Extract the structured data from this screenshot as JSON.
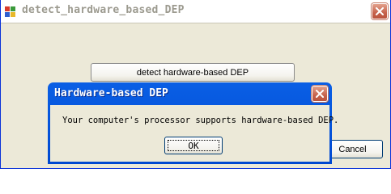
{
  "window": {
    "title": "detect_hardware_based_DEP",
    "app_icon": "application-icon",
    "close_icon": "close-icon"
  },
  "buttons": {
    "detect_label": "detect hardware-based DEP",
    "cancel_label": "Cancel"
  },
  "dialog": {
    "title": "Hardware-based DEP",
    "message": "Your computer's processor supports hardware-based DEP.",
    "ok_label": "OK",
    "close_icon": "close-icon"
  },
  "colors": {
    "dialog_titlebar": "#0054e3",
    "close_button": "#c6624c",
    "window_face": "#ece9d8"
  }
}
